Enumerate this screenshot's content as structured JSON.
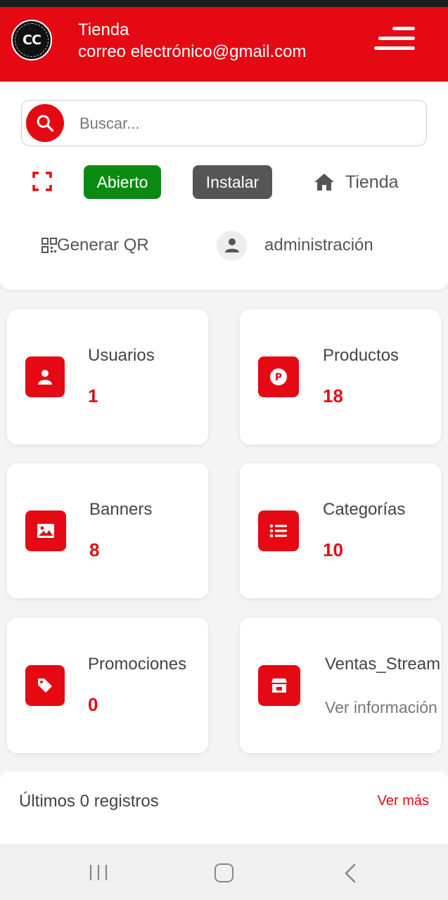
{
  "header": {
    "logo_text": "CC",
    "logo_ring_text": "STREAMING CATALOGOS CO",
    "title": "Tienda",
    "email": "correo electrónico@gmail.com",
    "menu_icon": "hamburger-menu-icon",
    "background": "#e50914"
  },
  "search": {
    "placeholder": "Buscar...",
    "icon": "search-icon"
  },
  "actions": {
    "scan_icon": "fullscreen-scan-icon",
    "open_label": "Abierto",
    "install_label": "Instalar",
    "store_label": "Tienda",
    "qr_label": "Generar QR",
    "admin_label": "administración"
  },
  "stats": [
    {
      "label": "Usuarios",
      "value": "1",
      "icon": "user-icon"
    },
    {
      "label": "Productos",
      "value": "18",
      "icon": "product-p-icon"
    },
    {
      "label": "Banners",
      "value": "8",
      "icon": "image-icon"
    },
    {
      "label": "Categorías",
      "value": "10",
      "icon": "list-icon"
    },
    {
      "label": "Promociones",
      "value": "0",
      "icon": "tag-icon"
    },
    {
      "label": "Ventas_Streaming",
      "subtext": "Ver información",
      "icon": "store-icon"
    }
  ],
  "records": {
    "title": "Últimos 0 registros",
    "more_label": "Ver más"
  },
  "colors": {
    "accent": "#e50914",
    "open_green": "#0b8a12",
    "install_gray": "#555555"
  }
}
